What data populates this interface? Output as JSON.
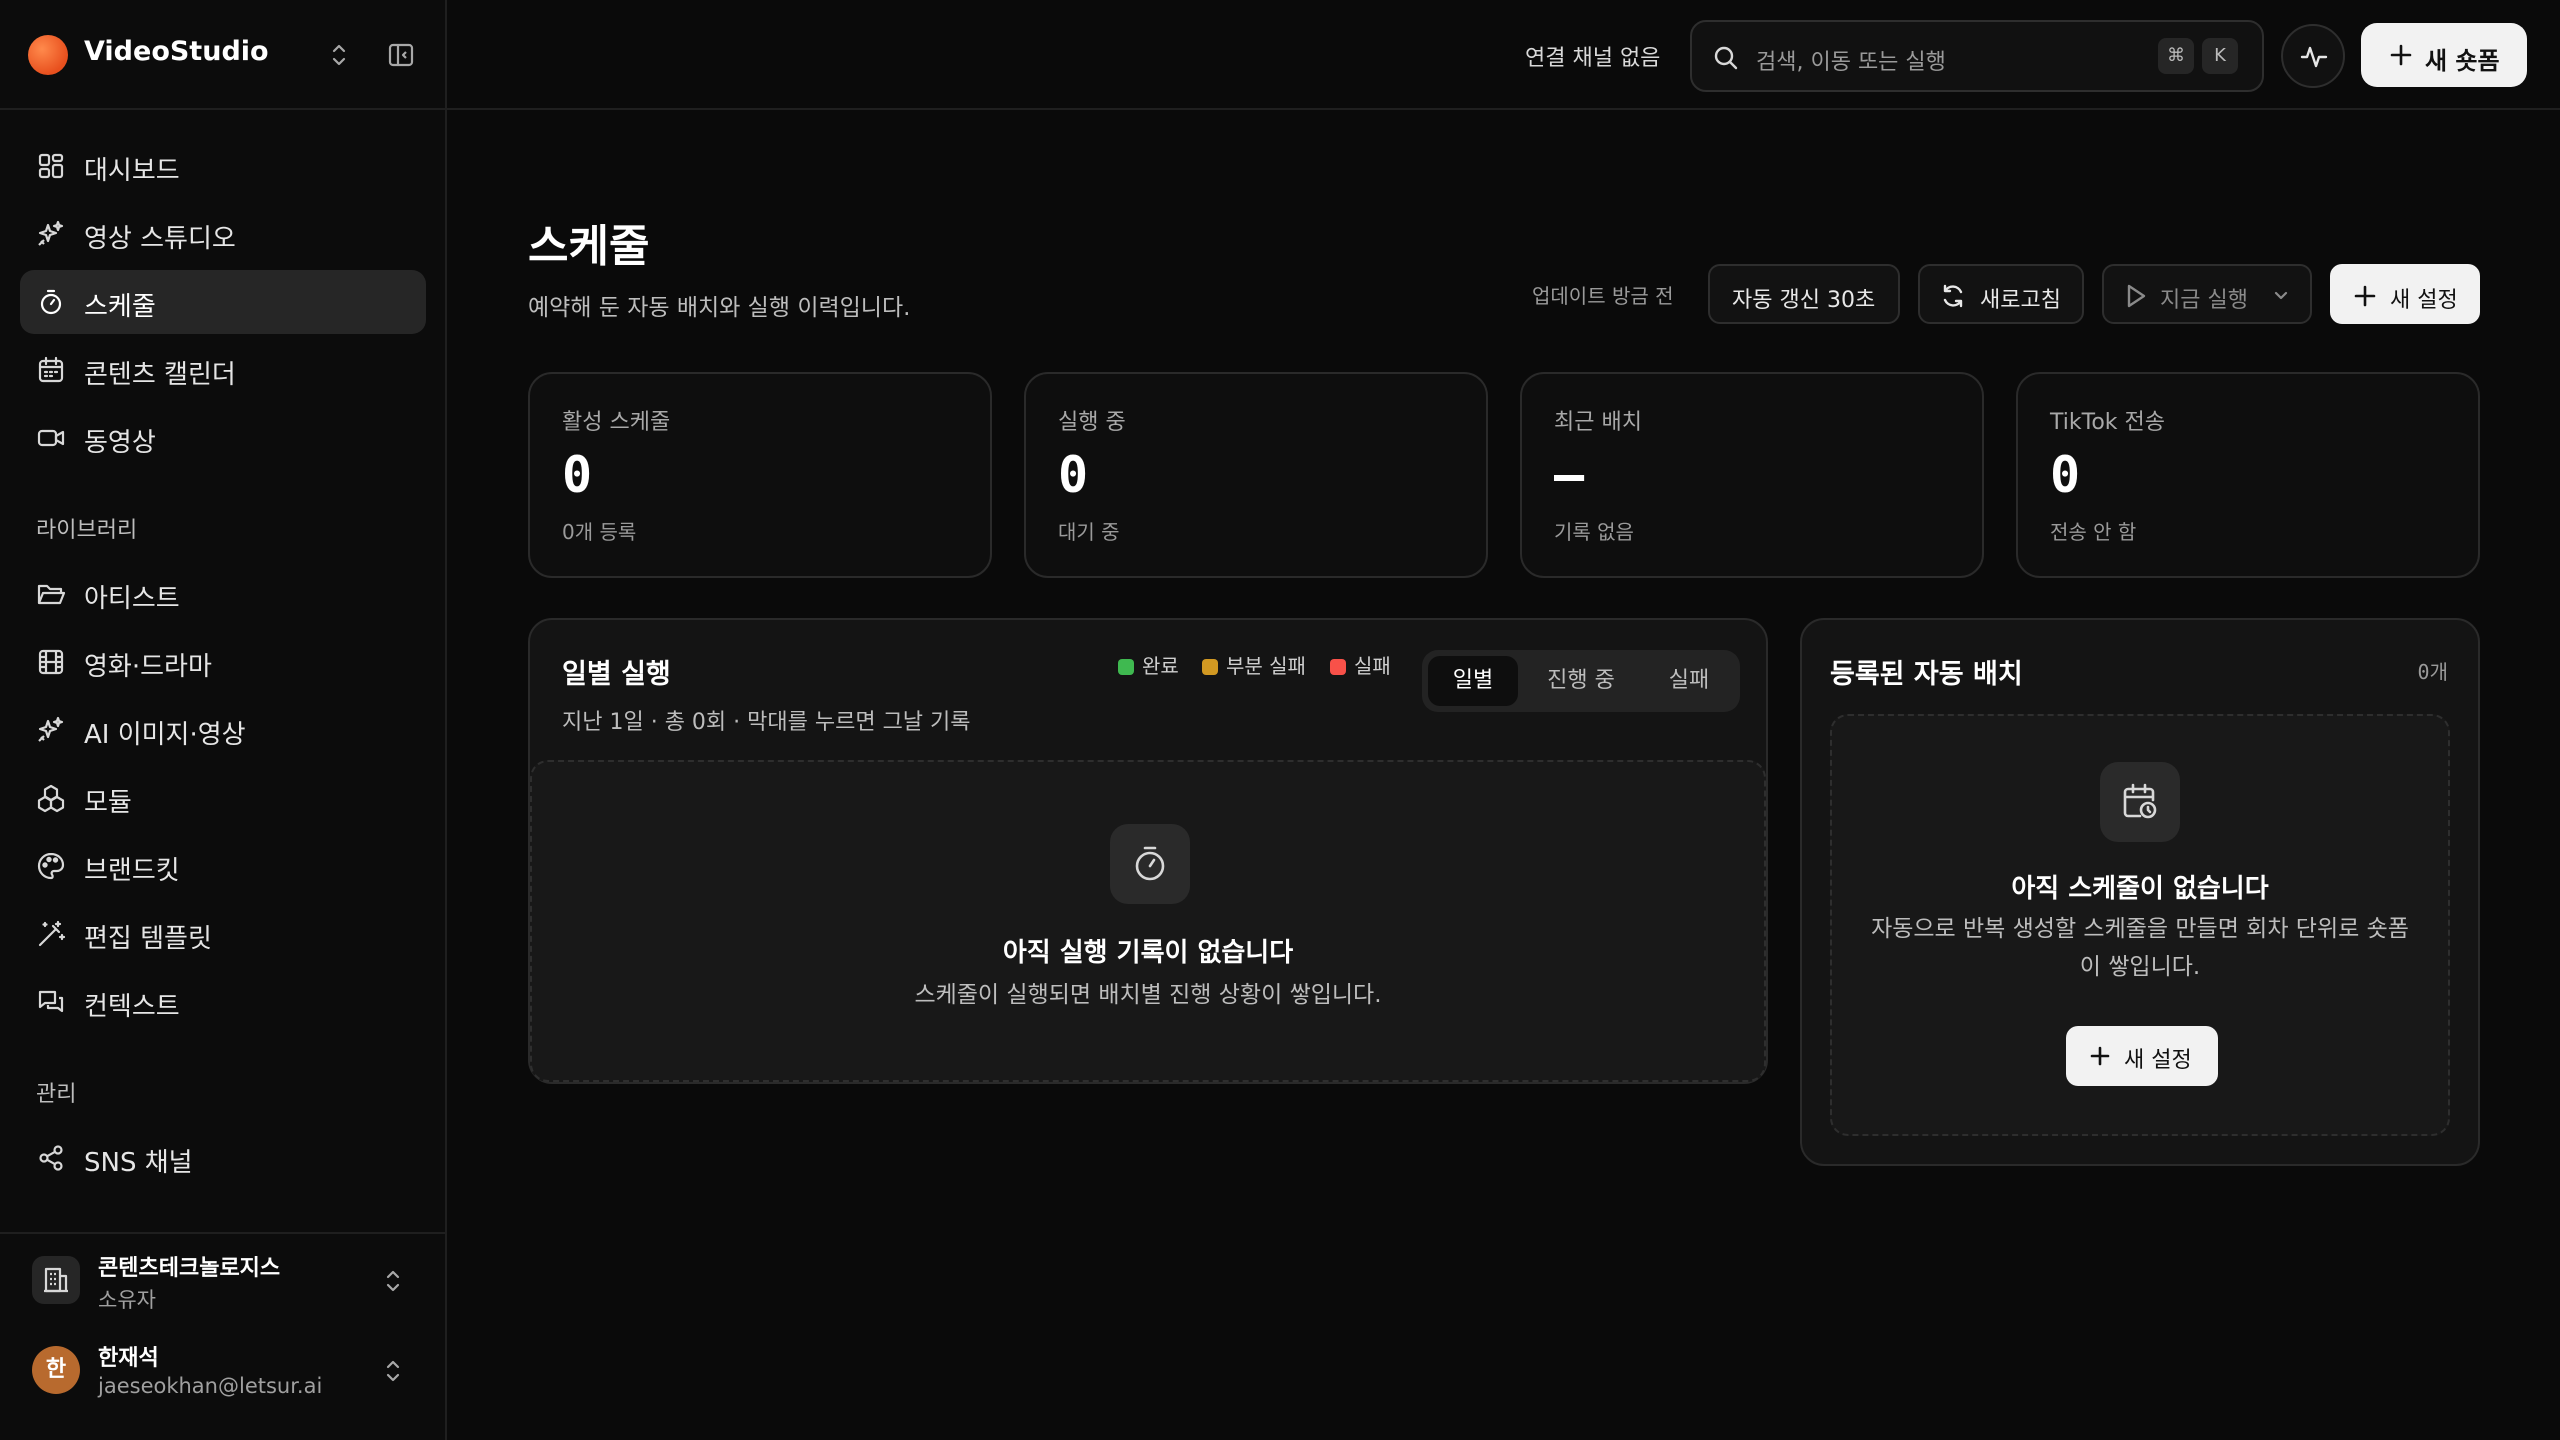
{
  "brand": {
    "name": "VideoStudio"
  },
  "nav": {
    "items": [
      {
        "label": "대시보드",
        "icon": "dashboard-icon"
      },
      {
        "label": "영상 스튜디오",
        "icon": "sparkles-icon"
      },
      {
        "label": "스케줄",
        "icon": "timer-icon",
        "active": true
      },
      {
        "label": "콘텐츠 캘린더",
        "icon": "calendar-icon"
      },
      {
        "label": "동영상",
        "icon": "video-icon"
      }
    ],
    "library_title": "라이브러리",
    "library": [
      {
        "label": "아티스트",
        "icon": "folder-icon"
      },
      {
        "label": "영화·드라마",
        "icon": "film-icon"
      },
      {
        "label": "AI 이미지·영상",
        "icon": "sparkles-icon"
      },
      {
        "label": "모듈",
        "icon": "modules-icon"
      },
      {
        "label": "브랜드킷",
        "icon": "palette-icon"
      },
      {
        "label": "편집 템플릿",
        "icon": "magic-wand-icon"
      },
      {
        "label": "컨텍스트",
        "icon": "messages-icon"
      }
    ],
    "admin_title": "관리",
    "admin": [
      {
        "label": "SNS 채널",
        "icon": "share-icon"
      }
    ]
  },
  "workspace": {
    "name": "콘텐츠테크놀로지스",
    "role": "소유자"
  },
  "user": {
    "initial": "한",
    "name": "한재석",
    "email": "jaeseokhan@letsur.ai"
  },
  "topbar": {
    "channel_status": "연결 채널 없음",
    "search_placeholder": "검색, 이동 또는 실행",
    "kbd_cmd": "⌘",
    "kbd_key": "K",
    "new_shorts": "새 숏폼"
  },
  "page": {
    "title": "스케줄",
    "subtitle": "예약해 둔 자동 배치와 실행 이력입니다.",
    "updated": "업데이트  방금  전",
    "auto_refresh": "자동 갱신 30초",
    "refresh": "새로고침",
    "run_now": "지금 실행",
    "new_setting": "새 설정"
  },
  "stats": [
    {
      "label": "활성 스케줄",
      "value": "0",
      "sub": "0개 등록"
    },
    {
      "label": "실행 중",
      "value": "0",
      "sub": "대기 중"
    },
    {
      "label": "최근 배치",
      "value": "—",
      "sub": "기록 없음"
    },
    {
      "label": "TikTok 전송",
      "value": "0",
      "sub": "전송 안 함"
    }
  ],
  "daily": {
    "title": "일별 실행",
    "subtitle": "지난 1일 · 총  0회  · 막대를 누르면 그날 기록",
    "legend": [
      {
        "label": "완료",
        "color": "#3fb950"
      },
      {
        "label": "부분 실패",
        "color": "#d29922"
      },
      {
        "label": "실패",
        "color": "#f85149"
      }
    ],
    "tabs": [
      "일별",
      "진행 중",
      "실패"
    ],
    "empty_title": "아직 실행 기록이 없습니다",
    "empty_text": "스케줄이 실행되면 배치별 진행 상황이 쌓입니다."
  },
  "batches": {
    "title": "등록된 자동 배치",
    "count": "0개",
    "empty_title": "아직 스케줄이 없습니다",
    "empty_text": "자동으로 반복 생성할 스케줄을 만들면 회차 단위로 숏폼이 쌓입니다.",
    "button": "새 설정"
  }
}
